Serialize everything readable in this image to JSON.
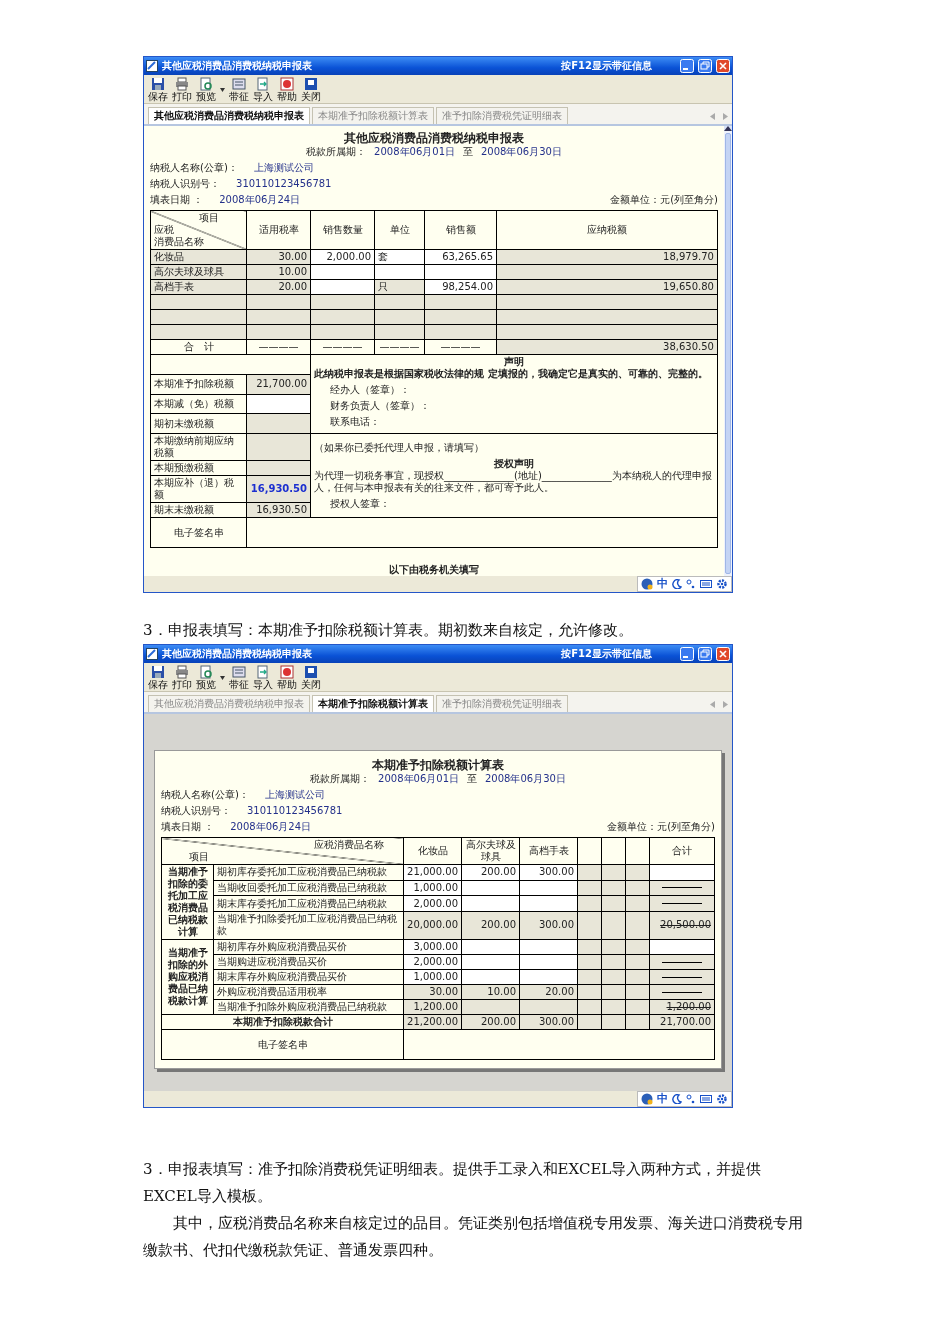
{
  "declaration_window": {
    "title": "其他应税消费品消费税纳税申报表",
    "f12_hint": "按F12显示带征信息",
    "toolbar": [
      {
        "label": "保存",
        "kind": "save",
        "dropdown": false
      },
      {
        "label": "打印",
        "kind": "print",
        "dropdown": false
      },
      {
        "label": "预览",
        "kind": "preview",
        "dropdown": true
      },
      {
        "label": "带征",
        "kind": "levy",
        "dropdown": false
      },
      {
        "label": "导入",
        "kind": "import",
        "dropdown": false
      },
      {
        "label": "帮助",
        "kind": "help",
        "dropdown": false
      },
      {
        "label": "关闭",
        "kind": "close",
        "dropdown": false
      }
    ],
    "tabs": [
      {
        "label": "其他应税消费品消费税纳税申报表",
        "selected": true
      },
      {
        "label": "本期准予扣除税额计算表",
        "selected": false
      },
      {
        "label": "准予扣除消费税凭证明细表",
        "selected": false
      }
    ],
    "form": {
      "title": "其他应税消费品消费税纳税申报表",
      "period": {
        "label": "税款所属期：",
        "from": "2008年06月01日",
        "to_label": "至",
        "to": "2008年06月30日"
      },
      "info": [
        {
          "label": "纳税人名称(公章)：",
          "value": "上海测试公司"
        },
        {
          "label": "纳税人识别号：",
          "value": "310110123456781"
        },
        {
          "label": "填表日期 ：",
          "value": "2008年06月24日"
        }
      ],
      "unit": "金额单位：元(列至角分)",
      "corner": {
        "top": "项目",
        "bottom": [
          "应税",
          "消费品名称"
        ]
      },
      "columns": [
        "适用税率",
        "销售数量",
        "单位",
        "销售额",
        "应纳税额"
      ],
      "rows": [
        {
          "name": "化妆品",
          "cells": {
            "column_1": "30.00",
            "column_2": "2,000.00",
            "column_3": "套",
            "column_4": "63,265.65",
            "column_5": "18,979.70"
          },
          "inputs": [
            false,
            true,
            true,
            true,
            false
          ]
        },
        {
          "name": "高尔夫球及球具",
          "cells": {
            "column_1": "10.00"
          },
          "inputs": [
            false,
            true,
            true,
            true,
            false
          ]
        },
        {
          "name": "高档手表",
          "cells": {
            "column_1": "20.00",
            "column_3": "只",
            "column_4": "98,254.00",
            "column_5": "19,650.80"
          },
          "inputs": [
            false,
            true,
            false,
            true,
            false
          ]
        },
        {
          "inputs": [
            false,
            false,
            false,
            false,
            false
          ]
        },
        {
          "inputs": [
            false,
            false,
            false,
            false,
            false
          ]
        },
        {
          "inputs": [
            false,
            false,
            false,
            false,
            false
          ]
        }
      ],
      "total": {
        "label": "合　计",
        "cells": [
          "————",
          "————",
          "————",
          "————",
          "38,630.50"
        ]
      },
      "summary": [
        {
          "label": "本期准予扣除税额",
          "value": "21,700.00",
          "input": false,
          "emphasis": false
        },
        {
          "label": "本期减（免）税额",
          "input": true
        },
        {
          "label": "期初未缴税额",
          "input": false
        },
        {
          "label": "本期缴纳前期应纳税额",
          "input": false
        },
        {
          "label": "本期预缴税额",
          "input": false
        },
        {
          "label": "本期应补（退）税额",
          "value": "16,930.50",
          "input": false,
          "emphasis": true
        },
        {
          "label": "期末未缴税额",
          "value": "16,930.50",
          "input": false,
          "emphasis": false
        }
      ],
      "declaration": {
        "heading": "声明",
        "statement": "此纳税申报表是根据国家税收法律的规 定填报的，我确定它是真实的、可靠的、完整的。",
        "signers": [
          "经办人（签章）：",
          "财务负责人（签章）：",
          "联系电话："
        ]
      },
      "authorization": {
        "note": "（如果你已委托代理人申报，请填写）",
        "heading": "授权声明",
        "text": "为代理一切税务事宜，现授权______________(地址)______________为本纳税人的代理申报人，任何与本申报表有关的往来文件，都可寄予此人。",
        "signer": "授权人签章："
      },
      "signature_label": "电子签名串",
      "footer": "以下由税务机关填写"
    },
    "ime_label": "中"
  },
  "caption": "3．申报表填写：本期准予扣除税额计算表。期初数来自核定，允许修改。",
  "deduction_window": {
    "title": "其他应税消费品消费税纳税申报表",
    "f12_hint": "按F12显示带征信息",
    "toolbar": [
      {
        "label": "保存",
        "kind": "save",
        "dropdown": false
      },
      {
        "label": "打印",
        "kind": "print",
        "dropdown": false
      },
      {
        "label": "预览",
        "kind": "preview",
        "dropdown": true
      },
      {
        "label": "带征",
        "kind": "levy",
        "dropdown": false
      },
      {
        "label": "导入",
        "kind": "import",
        "dropdown": false
      },
      {
        "label": "帮助",
        "kind": "help",
        "dropdown": false
      },
      {
        "label": "关闭",
        "kind": "close",
        "dropdown": false
      }
    ],
    "tabs": [
      {
        "label": "其他应税消费品消费税纳税申报表",
        "selected": false
      },
      {
        "label": "本期准予扣除税额计算表",
        "selected": true
      },
      {
        "label": "准予扣除消费税凭证明细表",
        "selected": false
      }
    ],
    "form": {
      "title": "本期准予扣除税额计算表",
      "period": {
        "label": "税款所属期：",
        "from": "2008年06月01日",
        "to_label": "至",
        "to": "2008年06月30日"
      },
      "info": [
        {
          "label": "纳税人名称(公章)：",
          "value": "上海测试公司"
        },
        {
          "label": "纳税人识别号：",
          "value": "310110123456781"
        },
        {
          "label": "填表日期 ：",
          "value": "2008年06月24日"
        }
      ],
      "unit": "金额单位：元(列至角分)",
      "corner": {
        "top": "应税消费品名称",
        "bottom": "项目"
      },
      "columns": [
        "化妆品",
        "高尔夫球及球具",
        "高档手表"
      ],
      "total_column": "合计",
      "groups": [
        {
          "label": "当期准予扣除的委托加工应税消费品已纳税款计算",
          "rows": [
            {
              "label": "期初库存委托加工应税消费品已纳税款",
              "values": {
                "column_1": "21,000.00",
                "column_2": "200.00",
                "column_3": "300.00"
              },
              "input": true,
              "kind": "blank"
            },
            {
              "label": "当期收回委托加工应税消费品已纳税款",
              "values": {
                "column_1": "1,000.00"
              },
              "input": true,
              "kind": "dash"
            },
            {
              "label": "期末库存委托加工应税消费品已纳税款",
              "values": {
                "column_1": "2,000.00"
              },
              "input": true,
              "kind": "dash"
            },
            {
              "label": "当期准予扣除委托加工应税消费品已纳税款",
              "values": {
                "column_1": "20,000.00",
                "column_2": "200.00",
                "column_3": "300.00"
              },
              "input": false,
              "kind": "struck",
              "total": "20,500.00"
            }
          ]
        },
        {
          "label": "当期准予扣除的外购应税消费品已纳税款计算",
          "rows": [
            {
              "label": "期初库存外购应税消费品买价",
              "values": {
                "column_1": "3,000.00"
              },
              "input": true,
              "kind": "blank"
            },
            {
              "label": "当期购进应税消费品买价",
              "values": {
                "column_1": "2,000.00"
              },
              "input": true,
              "kind": "dash"
            },
            {
              "label": "期末库存外购应税消费品买价",
              "values": {
                "column_1": "1,000.00"
              },
              "input": true,
              "kind": "dash"
            },
            {
              "label": "外购应税消费品适用税率",
              "values": {
                "column_1": "30.00",
                "column_2": "10.00",
                "column_3": "20.00"
              },
              "input": false,
              "kind": "dash"
            },
            {
              "label": "当期准予扣除外购应税消费品已纳税款",
              "values": {
                "column_1": "1,200.00"
              },
              "input": false,
              "kind": "struck",
              "total": "1,200.00"
            }
          ]
        }
      ],
      "grand_total": {
        "label": "本期准予扣除税款合计",
        "values": {
          "column_1": "21,200.00",
          "column_2": "200.00",
          "column_3": "300.00"
        },
        "total": "21,700.00"
      },
      "signature_label": "电子签名串"
    },
    "ime_label": "中"
  },
  "paragraphs": [
    "3．申报表填写：准予扣除消费税凭证明细表。提供手工录入和EXCEL导入两种方式，并提供EXCEL导入模板。",
    "其中，应税消费品名称来自核定过的品目。凭证类别包括增值税专用发票、海关进口消费税专用缴款书、代扣代缴税款凭证、普通发票四种。"
  ]
}
